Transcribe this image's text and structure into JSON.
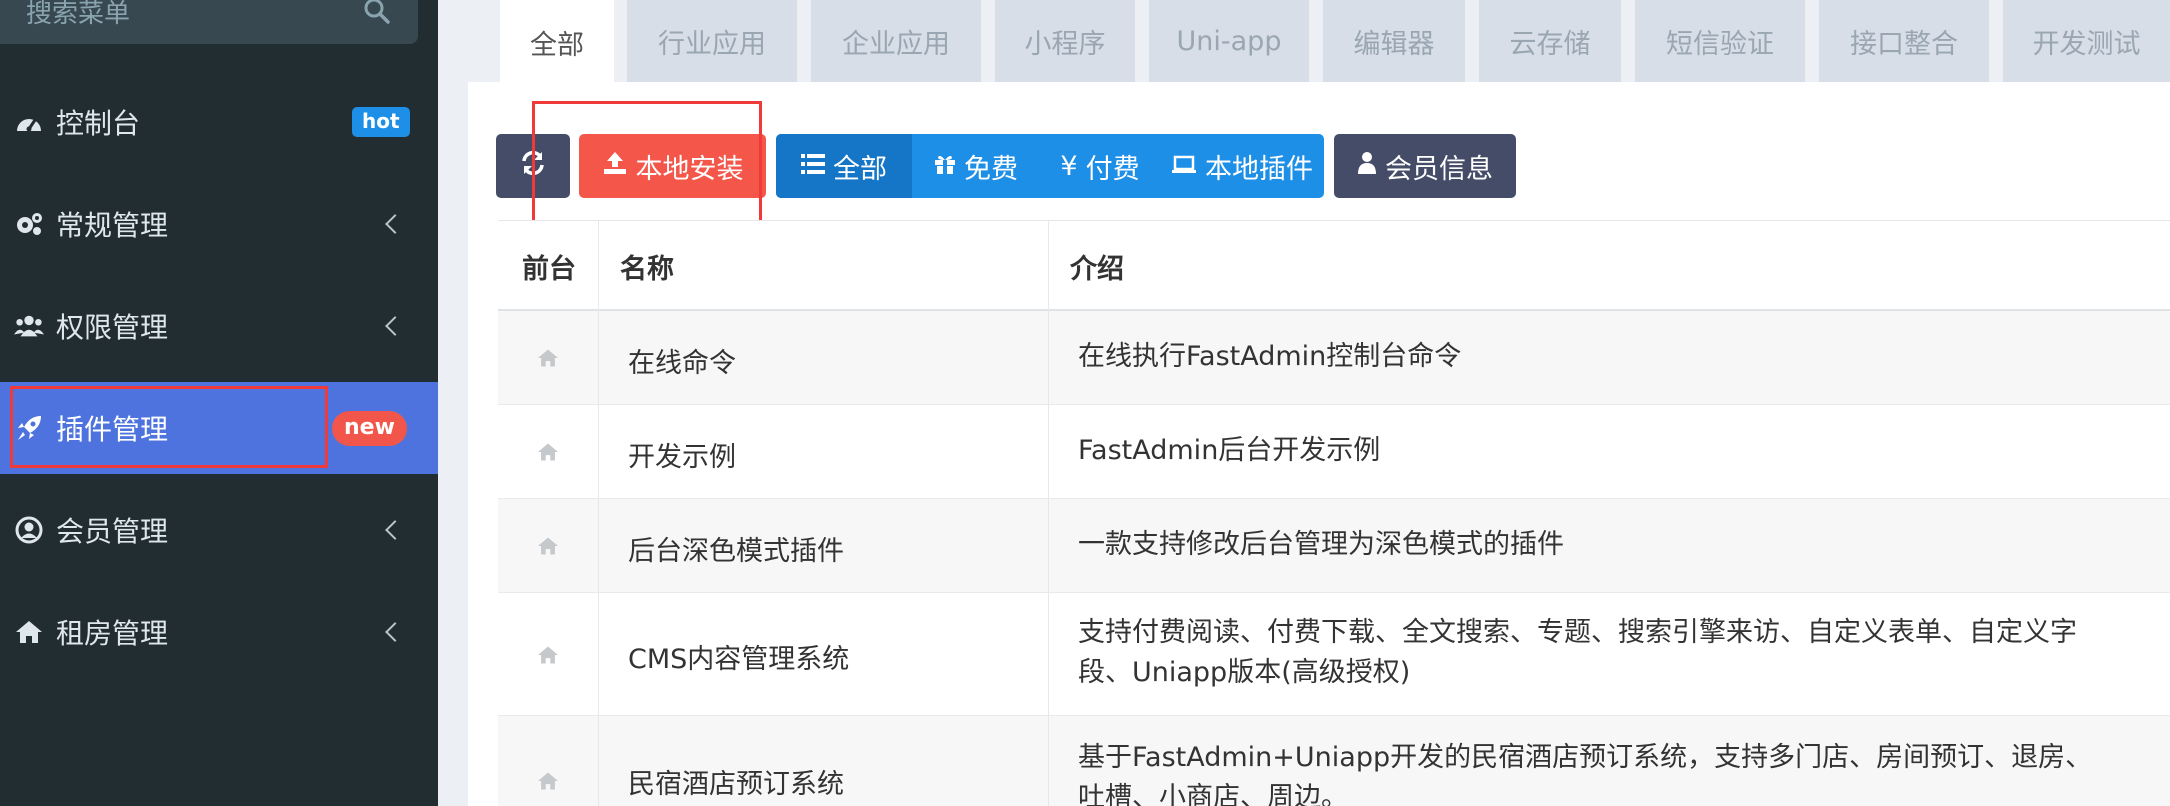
{
  "sidebar": {
    "search_placeholder": "搜索菜单",
    "items": [
      {
        "label": "控制台",
        "icon": "dashboard-icon",
        "badge": "hot"
      },
      {
        "label": "常规管理",
        "icon": "cogs-icon"
      },
      {
        "label": "权限管理",
        "icon": "users-icon"
      },
      {
        "label": "插件管理",
        "icon": "rocket-icon",
        "badge": "new",
        "active": true
      },
      {
        "label": "会员管理",
        "icon": "user-circle-icon"
      },
      {
        "label": "租房管理",
        "icon": "home-icon"
      }
    ]
  },
  "tabs": [
    "全部",
    "行业应用",
    "企业应用",
    "小程序",
    "Uni-app",
    "编辑器",
    "云存储",
    "短信验证",
    "接口整合",
    "开发测试"
  ],
  "toolbar": {
    "install_label": "本地安装",
    "filter_all": "全部",
    "filter_free": "免费",
    "filter_paid": "付费",
    "filter_local": "本地插件",
    "member_info": "会员信息"
  },
  "table": {
    "headers": {
      "frontend": "前台",
      "name": "名称",
      "intro": "介绍"
    },
    "rows": [
      {
        "name": "在线命令",
        "intro": "在线执行FastAdmin控制台命令"
      },
      {
        "name": "开发示例",
        "intro": "FastAdmin后台开发示例"
      },
      {
        "name": "后台深色模式插件",
        "intro": "一款支持修改后台管理为深色模式的插件"
      },
      {
        "name": "CMS内容管理系统",
        "intro": "支持付费阅读、付费下载、全文搜索、专题、搜索引擎来访、自定义表单、自定义字段、Uniapp版本(高级授权)"
      },
      {
        "name": "民宿酒店预订系统",
        "intro": "基于FastAdmin+Uniapp开发的民宿酒店预订系统，支持多门店、房间预订、退房、吐槽、小商店、周边。"
      }
    ]
  },
  "colors": {
    "sidebar_bg": "#222d32",
    "active_menu": "#4e73df",
    "install_btn": "#f4564a",
    "primary": "#1e8fe6",
    "highlight": "#f03a3a"
  }
}
